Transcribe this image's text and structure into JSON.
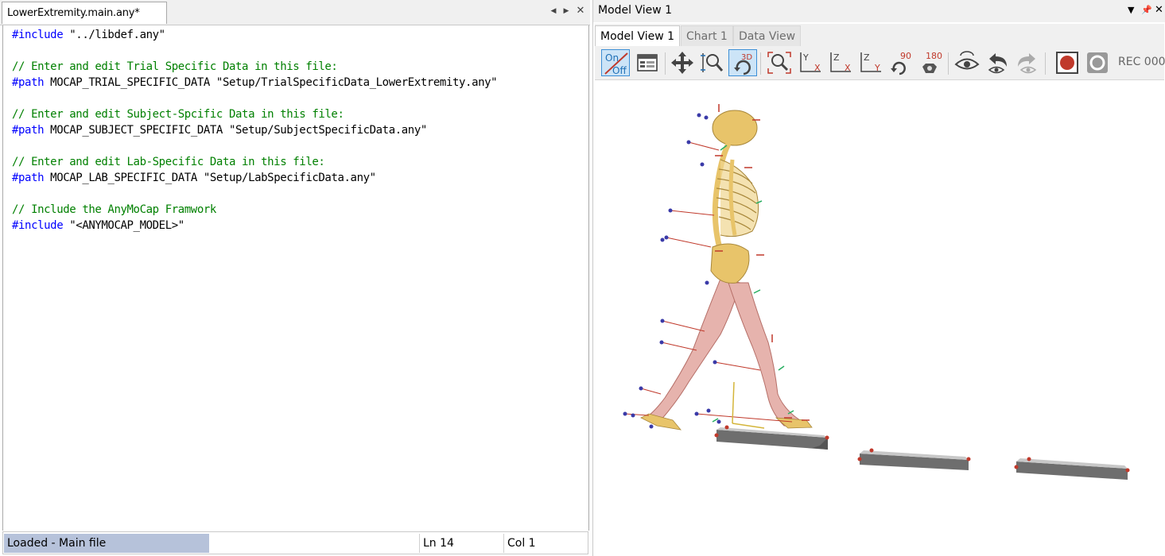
{
  "editor": {
    "tab_title": "LowerExtremity.main.any*",
    "code_lines": [
      [
        {
          "t": "#include",
          "c": "kw"
        },
        {
          "t": " \"../libdef.any\"",
          "c": ""
        }
      ],
      [],
      [
        {
          "t": "// Enter and edit Trial Specific Data in this file:",
          "c": "cm"
        }
      ],
      [
        {
          "t": "#path",
          "c": "kw"
        },
        {
          "t": " MOCAP_TRIAL_SPECIFIC_DATA \"Setup/TrialSpecificData_LowerExtremity.any\"",
          "c": ""
        }
      ],
      [],
      [
        {
          "t": "// Enter and edit Subject-Spcific Data in this file:",
          "c": "cm"
        }
      ],
      [
        {
          "t": "#path",
          "c": "kw"
        },
        {
          "t": " MOCAP_SUBJECT_SPECIFIC_DATA \"Setup/SubjectSpecificData.any\"",
          "c": ""
        }
      ],
      [],
      [
        {
          "t": "// Enter and edit Lab-Specific Data in this file:",
          "c": "cm"
        }
      ],
      [
        {
          "t": "#path",
          "c": "kw"
        },
        {
          "t": " MOCAP_LAB_SPECIFIC_DATA \"Setup/LabSpecificData.any\"",
          "c": ""
        }
      ],
      [],
      [
        {
          "t": "// Include the AnyMoCap Framwork",
          "c": "cm"
        }
      ],
      [
        {
          "t": "#include",
          "c": "kw"
        },
        {
          "t": " \"<ANYMOCAP_MODEL>\"",
          "c": ""
        }
      ]
    ],
    "status": {
      "main": "Loaded - Main file",
      "line": "Ln 14",
      "col": "Col 1"
    }
  },
  "model_view": {
    "title": "Model View 1",
    "tabs": [
      "Model View 1",
      "Chart 1",
      "Data View"
    ],
    "active_tab": 0,
    "toolbar": {
      "onoff_on": "On",
      "onoff_off": "Off",
      "view3d": "3D",
      "rot90": "90",
      "rot180": "180",
      "axis_y": "Y",
      "axis_x": "X",
      "axis_z": "Z",
      "rec_label": "REC  000"
    }
  },
  "colors": {
    "keyword": "#0000ff",
    "comment": "#008000",
    "status_highlight": "#b6c2da",
    "record_red": "#c0392b",
    "bone": "#e8c46a",
    "muscle": "#e6b3ad",
    "marker": "#3a3aa8",
    "plate": "#8a8a8a"
  },
  "icons": [
    "onoff-icon",
    "options-icon",
    "pan-icon",
    "zoom-icon",
    "rotate3d-icon",
    "zoom-extents-icon",
    "view-yx-icon",
    "view-zx-icon",
    "view-zy-icon",
    "rotate90-icon",
    "rotate180-icon",
    "eye-icon",
    "undo-view-icon",
    "redo-view-icon",
    "record-icon",
    "stop-icon"
  ]
}
